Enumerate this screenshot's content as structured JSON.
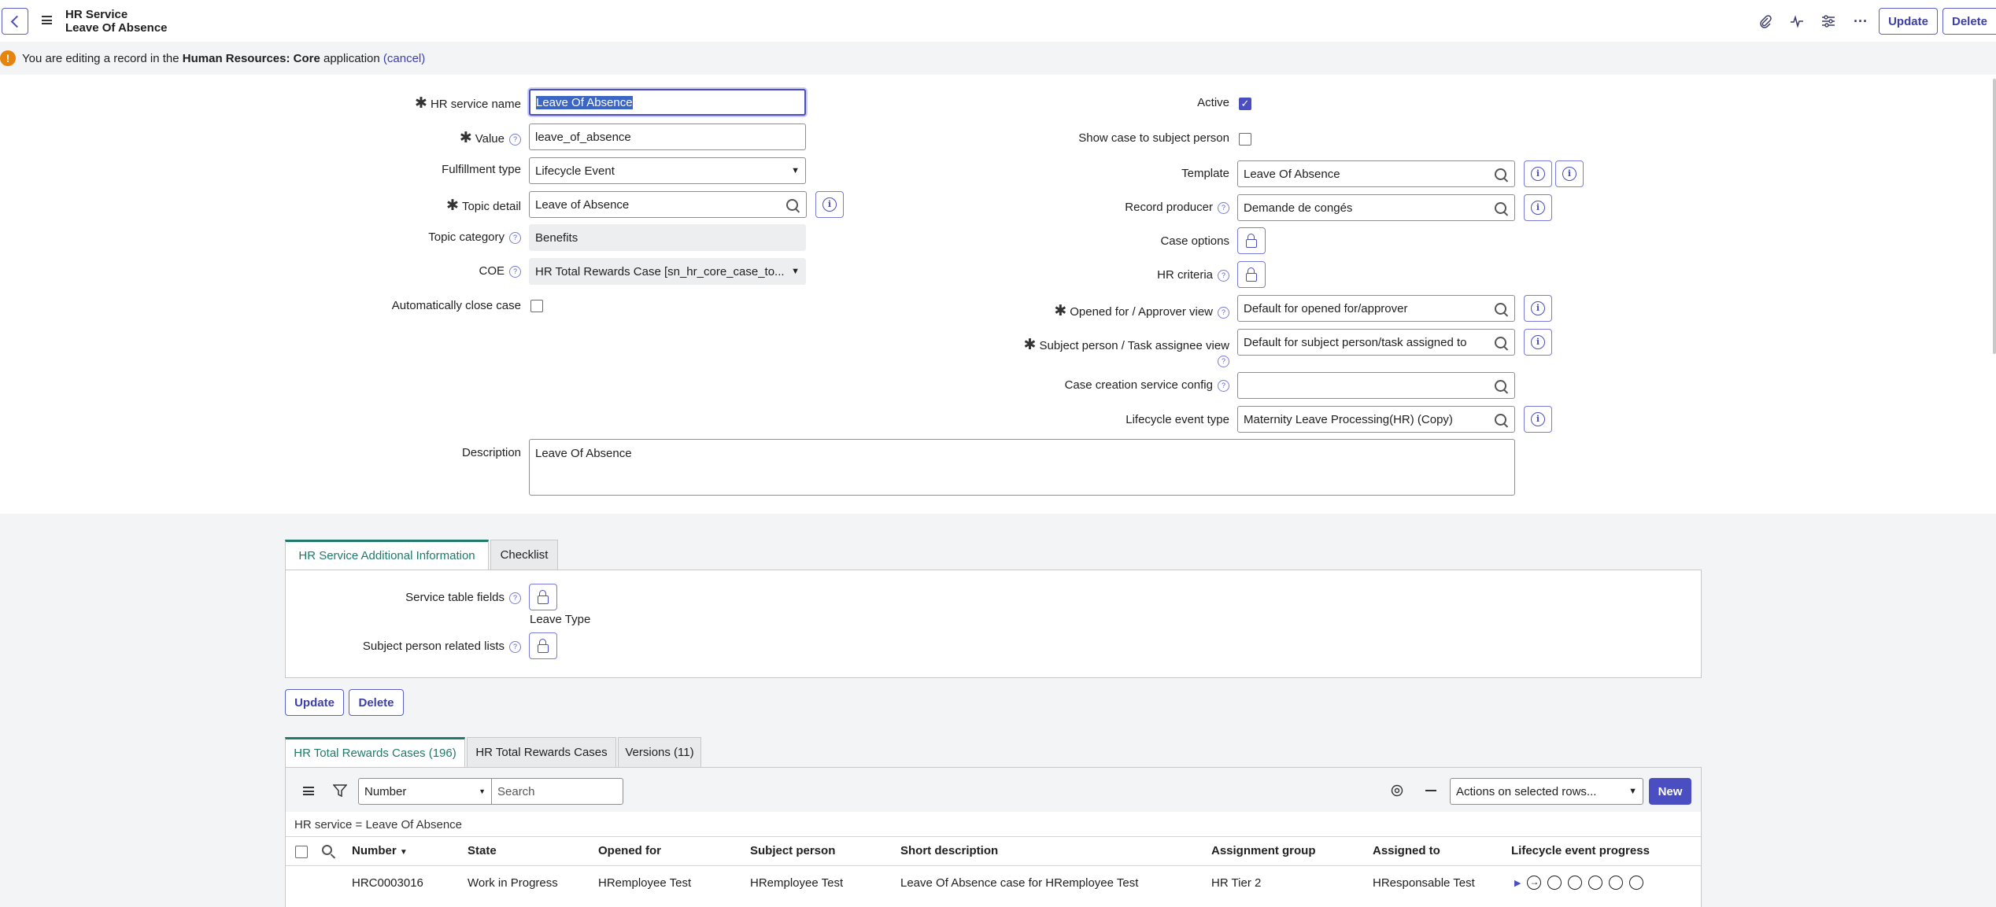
{
  "header": {
    "title": "HR Service",
    "subtitle": "Leave Of Absence",
    "update_label": "Update",
    "delete_label": "Delete"
  },
  "banner": {
    "prefix": "You are editing a record in the ",
    "app_name": "Human Resources: Core",
    "suffix": " application ",
    "cancel": "(cancel)"
  },
  "left_form": {
    "hr_service_name_label": "HR service name",
    "hr_service_name_value": "Leave Of Absence",
    "value_label": "Value",
    "value_value": "leave_of_absence",
    "fulfillment_type_label": "Fulfillment type",
    "fulfillment_type_value": "Lifecycle Event",
    "topic_detail_label": "Topic detail",
    "topic_detail_value": "Leave of Absence",
    "topic_category_label": "Topic category",
    "topic_category_value": "Benefits",
    "coe_label": "COE",
    "coe_value": "HR Total Rewards Case [sn_hr_core_case_to...",
    "auto_close_label": "Automatically close case",
    "description_label": "Description",
    "description_value": "Leave Of Absence"
  },
  "right_form": {
    "active_label": "Active",
    "show_case_label": "Show case to subject person",
    "template_label": "Template",
    "template_value": "Leave Of Absence",
    "record_producer_label": "Record producer",
    "record_producer_value": "Demande de congés",
    "case_options_label": "Case options",
    "hr_criteria_label": "HR criteria",
    "opened_for_label": "Opened for / Approver view",
    "opened_for_value": "Default for opened for/approver",
    "subject_person_label": "Subject person / Task assignee view",
    "subject_person_value": "Default for subject person/task assigned to",
    "case_creation_label": "Case creation service config",
    "case_creation_value": "",
    "lifecycle_label": "Lifecycle event type",
    "lifecycle_value": "Maternity Leave Processing(HR) (Copy)"
  },
  "section_tabs": {
    "tab1": "HR Service Additional Information",
    "tab2": "Checklist"
  },
  "additional_info": {
    "service_table_fields_label": "Service table fields",
    "service_table_fields_value": "Leave Type",
    "subject_related_lists_label": "Subject person related lists"
  },
  "bottom_buttons": {
    "update": "Update",
    "delete": "Delete"
  },
  "related_tabs": {
    "tab1": "HR Total Rewards Cases (196)",
    "tab2": "HR Total Rewards Cases",
    "tab3": "Versions (11)"
  },
  "list_toolbar": {
    "field_select": "Number",
    "search_placeholder": "Search",
    "actions_select": "Actions on selected rows...",
    "new_label": "New",
    "filter_text": "HR service = Leave Of Absence"
  },
  "table": {
    "columns": [
      "Number",
      "State",
      "Opened for",
      "Subject person",
      "Short description",
      "Assignment group",
      "Assigned to",
      "Lifecycle event progress"
    ],
    "rows": [
      {
        "number": "HRC0003016",
        "state": "Work in Progress",
        "opened_for": "HRemployee Test",
        "subject_person": "HRemployee Test",
        "short_description": "Leave Of Absence case for HRemployee Test",
        "assignment_group": "HR Tier 2",
        "assigned_to": "HResponsable Test"
      }
    ]
  },
  "colors": {
    "accent": "#4a4ec0",
    "active_tab": "#1f7a6b",
    "warning": "#e8830c"
  }
}
